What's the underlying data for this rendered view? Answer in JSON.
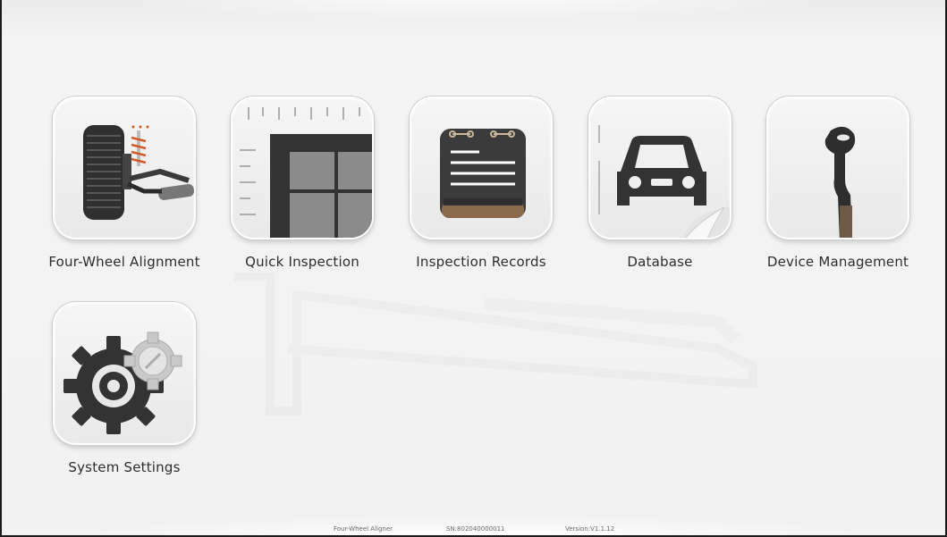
{
  "menu": {
    "items": [
      {
        "label": "Four-Wheel Alignment",
        "icon": "wheel-alignment-icon"
      },
      {
        "label": "Quick Inspection",
        "icon": "ruler-grid-icon"
      },
      {
        "label": "Inspection Records",
        "icon": "clipboard-records-icon"
      },
      {
        "label": "Database",
        "icon": "car-database-icon"
      },
      {
        "label": "Device Management",
        "icon": "clamp-device-icon"
      },
      {
        "label": "System Settings",
        "icon": "gears-settings-icon"
      }
    ]
  },
  "footer": {
    "product": "Four-Wheel Aligner",
    "serial": "SN:802040000011",
    "version": "Version:V1.1.12"
  },
  "colors": {
    "background": "#f1f1f1",
    "icon_dark": "#3a3a3a",
    "label_text": "#2d2d2d"
  }
}
